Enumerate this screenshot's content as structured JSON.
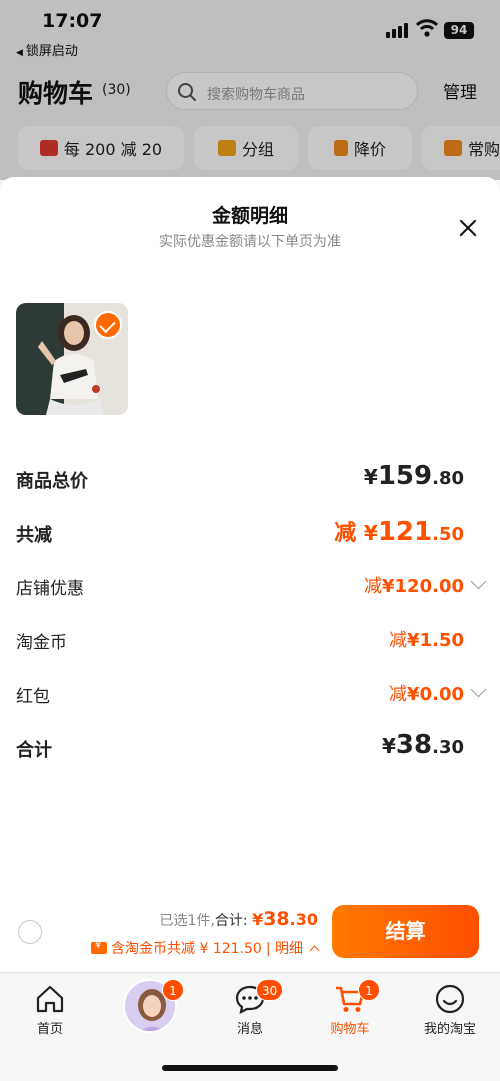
{
  "status_bar": {
    "time": "17:07",
    "back_label": "锁屏启动",
    "battery": "94"
  },
  "cart_header": {
    "title": "购物车",
    "count": "(30)",
    "search_placeholder": "搜索购物车商品",
    "manage_label": "管理"
  },
  "filters": [
    {
      "label": "每 200 减 20",
      "icon": "gift-coupon-icon"
    },
    {
      "label": "分组",
      "icon": "folder-icon"
    },
    {
      "label": "降价",
      "icon": "down-arrow-icon"
    },
    {
      "label": "常购",
      "icon": "cart-icon"
    }
  ],
  "sheet": {
    "title": "金额明细",
    "subtitle": "实际优惠金额请以下单页为准",
    "rows": [
      {
        "label": "商品总价",
        "yen": "¥",
        "int": "159",
        "dec": ".80",
        "prefix": ""
      },
      {
        "label": "共减",
        "yen": "¥",
        "int": "121",
        "dec": ".50",
        "prefix": "减 "
      },
      {
        "label": "店铺优惠",
        "yen": "¥",
        "int": "120",
        "dec": ".00",
        "prefix": "减"
      },
      {
        "label": "淘金币",
        "yen": "¥",
        "int": "1",
        "dec": ".50",
        "prefix": "减"
      },
      {
        "label": "红包",
        "yen": "¥",
        "int": "0",
        "dec": ".00",
        "prefix": "减"
      },
      {
        "label": "合计",
        "yen": "¥",
        "int": "38",
        "dec": ".30",
        "prefix": ""
      }
    ]
  },
  "checkout": {
    "selected_text": "已选1件,",
    "total_label": "合计:",
    "total_yen": "¥",
    "total_int": "38",
    "total_dec": ".30",
    "coin_text": "含淘金币共减 ¥ 121.50",
    "detail_label": "| 明细",
    "settle_label": "结算"
  },
  "tabbar": {
    "items": [
      {
        "label": "首页",
        "icon": "home-icon",
        "badge": ""
      },
      {
        "label": "",
        "icon": "avatar",
        "badge": "1"
      },
      {
        "label": "消息",
        "icon": "message-icon",
        "badge": "30"
      },
      {
        "label": "购物车",
        "icon": "cart-icon",
        "badge": "1"
      },
      {
        "label": "我的淘宝",
        "icon": "profile-icon",
        "badge": ""
      }
    ]
  },
  "colors": {
    "accent": "#ff5000",
    "accent_gradient_start": "#ff7a00",
    "accent_gradient_end": "#ff4e00"
  }
}
